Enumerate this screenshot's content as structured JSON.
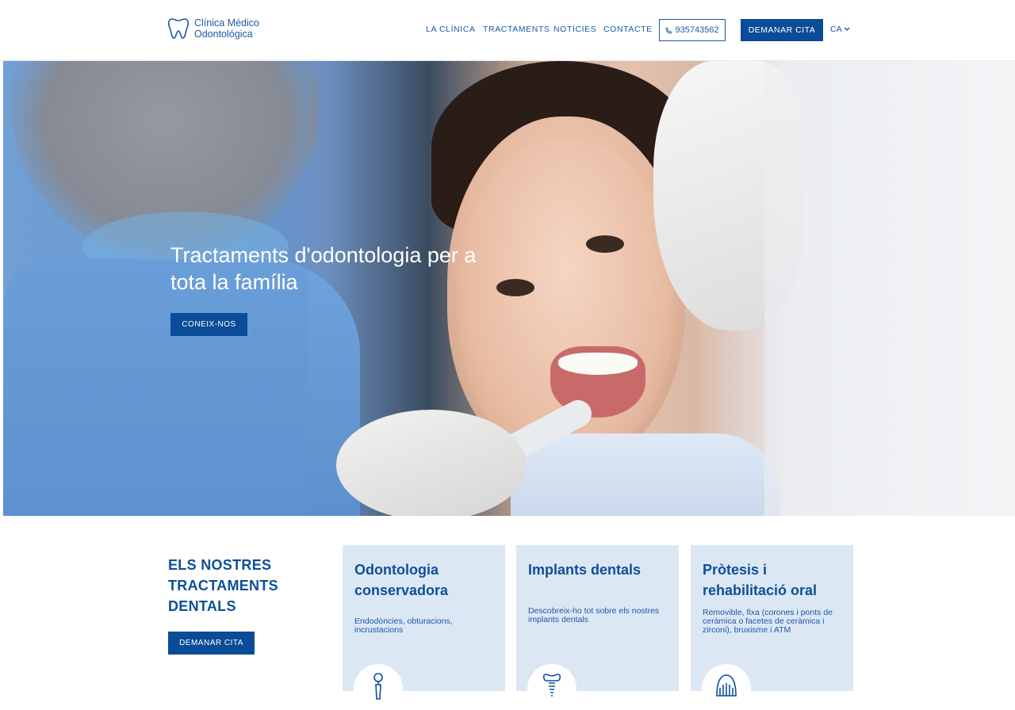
{
  "logo": {
    "line1": "Clínica Médico",
    "line2": "Odontológica"
  },
  "nav": [
    {
      "label": "LA CLÍNICA"
    },
    {
      "label": "TRACTAMENTS"
    },
    {
      "label": "NOTÍCIES"
    },
    {
      "label": "CONTACTE"
    }
  ],
  "header": {
    "phone": "935743562",
    "cta_label": "DEMANAR CITA",
    "lang": "CA"
  },
  "hero": {
    "title": "Tractaments d'odontologia per a tota la família",
    "button": "CONEIX-NOS"
  },
  "treatments": {
    "title": "ELS NOSTRES TRACTAMENTS DENTALS",
    "button": "DEMANAR CITA",
    "cards": [
      {
        "title": "Odontologia conservadora",
        "text": "Endodòncies, obturacions, incrustacions",
        "icon": "dental-mirror-icon"
      },
      {
        "title": "Implants dentals",
        "text": "Descobreix-ho tot sobre els nostres implants dentals",
        "icon": "dental-implant-icon"
      },
      {
        "title": "Pròtesis i rehabilitació oral",
        "text": "Removible, fixa (corones i ponts de ceràmica o facetes de ceràmica i zirconi), bruxisme i ATM",
        "icon": "denture-icon"
      }
    ]
  },
  "colors": {
    "brand_blue": "#0a4c97",
    "card_bg": "#dce7f4",
    "text_blue": "#0d4f99"
  }
}
